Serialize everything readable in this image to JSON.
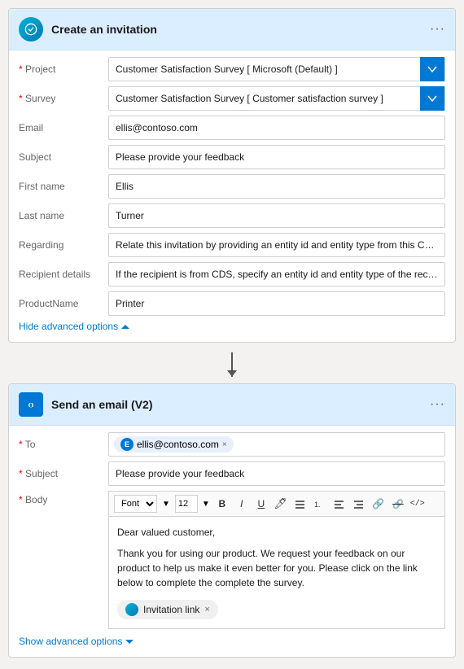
{
  "card1": {
    "title": "Create an invitation",
    "icon_alt": "survey-icon",
    "fields": [
      {
        "label": "Project",
        "required": true,
        "type": "dropdown",
        "value": "Customer Satisfaction Survey [ Microsoft (Default) ]"
      },
      {
        "label": "Survey",
        "required": true,
        "type": "dropdown",
        "value": "Customer Satisfaction Survey [ Customer satisfaction survey ]"
      },
      {
        "label": "Email",
        "required": false,
        "type": "text",
        "value": "ellis@contoso.com"
      },
      {
        "label": "Subject",
        "required": false,
        "type": "text",
        "value": "Please provide your feedback"
      },
      {
        "label": "First name",
        "required": false,
        "type": "text",
        "value": "Ellis"
      },
      {
        "label": "Last name",
        "required": false,
        "type": "text",
        "value": "Turner"
      },
      {
        "label": "Regarding",
        "required": false,
        "type": "text",
        "value": "Relate this invitation by providing an entity id and entity type from this CDS i"
      },
      {
        "label": "Recipient details",
        "required": false,
        "type": "text",
        "value": "If the recipient is from CDS, specify an entity id and entity type of the recipient"
      },
      {
        "label": "ProductName",
        "required": false,
        "type": "text",
        "value": "Printer"
      }
    ],
    "hide_advanced": "Hide advanced options"
  },
  "card2": {
    "title": "Send an email (V2)",
    "icon_alt": "email-icon",
    "to_label": "To",
    "to_required": true,
    "to_value": "ellis@contoso.com",
    "to_avatar": "E",
    "subject_label": "Subject",
    "subject_required": true,
    "subject_value": "Please provide your feedback",
    "body_label": "Body",
    "body_required": true,
    "toolbar": {
      "font": "Font",
      "size": "12",
      "bold": "B",
      "italic": "I",
      "underline": "U"
    },
    "body_line1": "Dear valued customer,",
    "body_line2": "Thank you for using our product. We request your feedback on our product to help us make it even better for you. Please click on the link below to complete the complete the survey.",
    "invitation_tag": "Invitation link",
    "show_advanced": "Show advanced options"
  }
}
